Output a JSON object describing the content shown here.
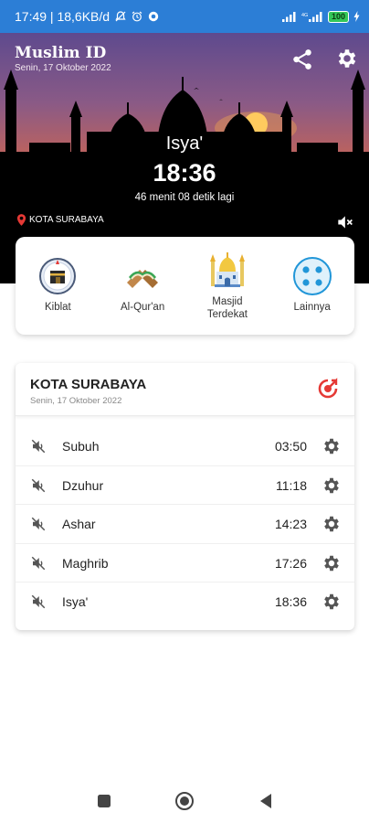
{
  "status_bar": {
    "time_speed": "17:49 | 18,6KB/d",
    "battery": "100",
    "icons": [
      "mute-alarm-icon",
      "alarm-icon",
      "record-icon",
      "signal-icon",
      "signal-icon",
      "battery-icon",
      "charging-icon"
    ]
  },
  "header": {
    "app_title": "Muslim ID",
    "date": "Senin, 17 Oktober 2022",
    "share_icon": "share-icon",
    "settings_icon": "gear-icon"
  },
  "current_prayer": {
    "name": "Isya'",
    "time": "18:36",
    "countdown": "46 menit 08 detik lagi"
  },
  "location": {
    "label": "KOTA SURABAYA",
    "icon": "location-pin-icon"
  },
  "shortcuts": [
    {
      "label": "Kiblat",
      "icon": "kaaba-icon"
    },
    {
      "label": "Al-Qur'an",
      "icon": "quran-icon"
    },
    {
      "label": "Masjid Terdekat",
      "icon": "mosque-icon"
    },
    {
      "label": "Lainnya",
      "icon": "more-icon"
    }
  ],
  "schedule": {
    "city": "KOTA SURABAYA",
    "date": "Senin, 17 Oktober 2022",
    "prayers": [
      {
        "name": "Subuh",
        "time": "03:50"
      },
      {
        "name": "Dzuhur",
        "time": "11:18"
      },
      {
        "name": "Ashar",
        "time": "14:23"
      },
      {
        "name": "Maghrib",
        "time": "17:26"
      },
      {
        "name": "Isya'",
        "time": "18:36"
      }
    ]
  },
  "colors": {
    "status_bar": "#2c7ed6",
    "accent_red": "#e53935",
    "icon_grey": "#555555"
  }
}
